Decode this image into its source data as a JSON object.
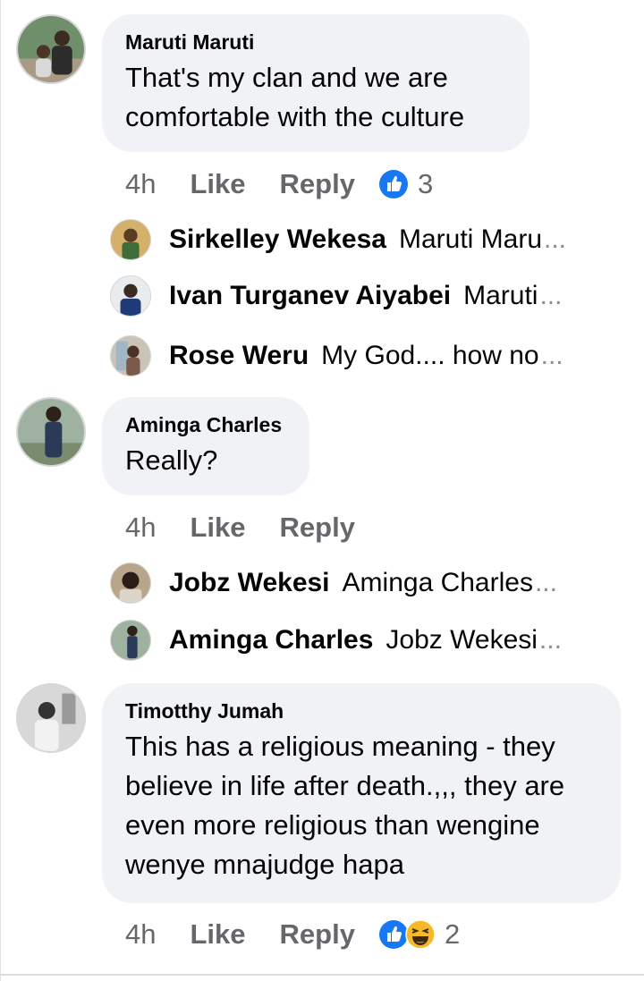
{
  "comments": [
    {
      "author": "Maruti Maruti",
      "text_lines": [
        "That's my clan and we are",
        "comfortable with the culture"
      ],
      "time": "4h",
      "like_label": "Like",
      "reply_label": "Reply",
      "reaction_count": "3",
      "reactions": [
        "like-icon"
      ],
      "replies": [
        {
          "name": "Sirkelley Wekesa",
          "text": "Maruti Maru",
          "ellipsis": "..."
        },
        {
          "name": "Ivan Turganev Aiyabei",
          "text": "Maruti",
          "ellipsis": "..."
        },
        {
          "name": "Rose Weru",
          "text": "My God.... how no",
          "ellipsis": "..."
        }
      ]
    },
    {
      "author": "Aminga Charles",
      "text_lines": [
        "Really?"
      ],
      "time": "4h",
      "like_label": "Like",
      "reply_label": "Reply",
      "replies": [
        {
          "name": "Jobz Wekesi",
          "text": "Aminga Charles",
          "ellipsis": "..."
        },
        {
          "name": "Aminga Charles",
          "text": "Jobz Wekesi",
          "ellipsis": "..."
        }
      ]
    },
    {
      "author": "Timotthy Jumah",
      "text_lines": [
        "This has a religious meaning  - they",
        "believe in life after death.,,, they are",
        "even more religious than wengine",
        "wenye mnajudge hapa"
      ],
      "time": "4h",
      "like_label": "Like",
      "reply_label": "Reply",
      "reaction_count": "2",
      "reactions": [
        "like-icon",
        "laughing-emoji-icon"
      ]
    }
  ],
  "colors": {
    "bubble": "#f0f2f5",
    "secondary_text": "#65676b",
    "like_blue": "#1877f2",
    "haha_yellow": "#f7b928"
  }
}
